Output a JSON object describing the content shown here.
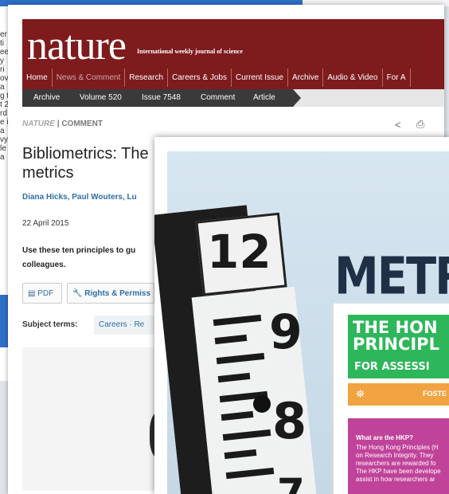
{
  "background_window": {
    "edge_letters": [
      "er",
      "ti",
      "ee",
      "y",
      "ri",
      "",
      "",
      "ov",
      "a",
      "g t",
      "t 2",
      "rd",
      "e i",
      "a",
      "vy",
      "le",
      "a"
    ]
  },
  "article_window": {
    "logo": "nature",
    "tagline": "International weekly journal of science",
    "nav": [
      {
        "label": "Home",
        "dim": false
      },
      {
        "label": "News & Comment",
        "dim": true
      },
      {
        "label": "Research",
        "dim": false
      },
      {
        "label": "Careers & Jobs",
        "dim": false
      },
      {
        "label": "Current Issue",
        "dim": false
      },
      {
        "label": "Archive",
        "dim": false
      },
      {
        "label": "Audio & Video",
        "dim": false
      },
      {
        "label": "For A",
        "dim": false
      }
    ],
    "breadcrumbs": [
      "Archive",
      "Volume 520",
      "Issue 7548",
      "Comment",
      "Article"
    ],
    "section_journal": "NATURE",
    "section_sep": "|",
    "section_type": "COMMENT",
    "title": "Bibliometrics: The metrics",
    "authors": "Diana Hicks, Paul Wouters, Lu",
    "date": "22 April 2015",
    "summary": "Use these ten principles to gu colleagues.",
    "pdf_label": "PDF",
    "rights_label": "Rights & Permiss",
    "subject_label": "Subject terms:",
    "subject_links": "Careers · Re"
  },
  "poster_window": {
    "gauge_numbers": [
      "12",
      "9",
      "8",
      "7"
    ],
    "headline": "METR",
    "card_title_line1": "THE HON",
    "card_title_line2": "PRINCIPL",
    "card_subtitle": "FOR ASSESSI",
    "card_orange_text": "FOSTE",
    "card_question": "What are the HKP?",
    "card_body": [
      "The Hong Kong Principles (H",
      "on Research Integrity. They",
      "researchers are rewarded fo",
      "The HKP have been develope",
      "assist in how researchers ar"
    ]
  },
  "colors": {
    "masthead": "#7e1b1d",
    "link": "#2f6fa5",
    "green": "#2db75a",
    "orange": "#f0a340",
    "purple": "#c0439a"
  }
}
